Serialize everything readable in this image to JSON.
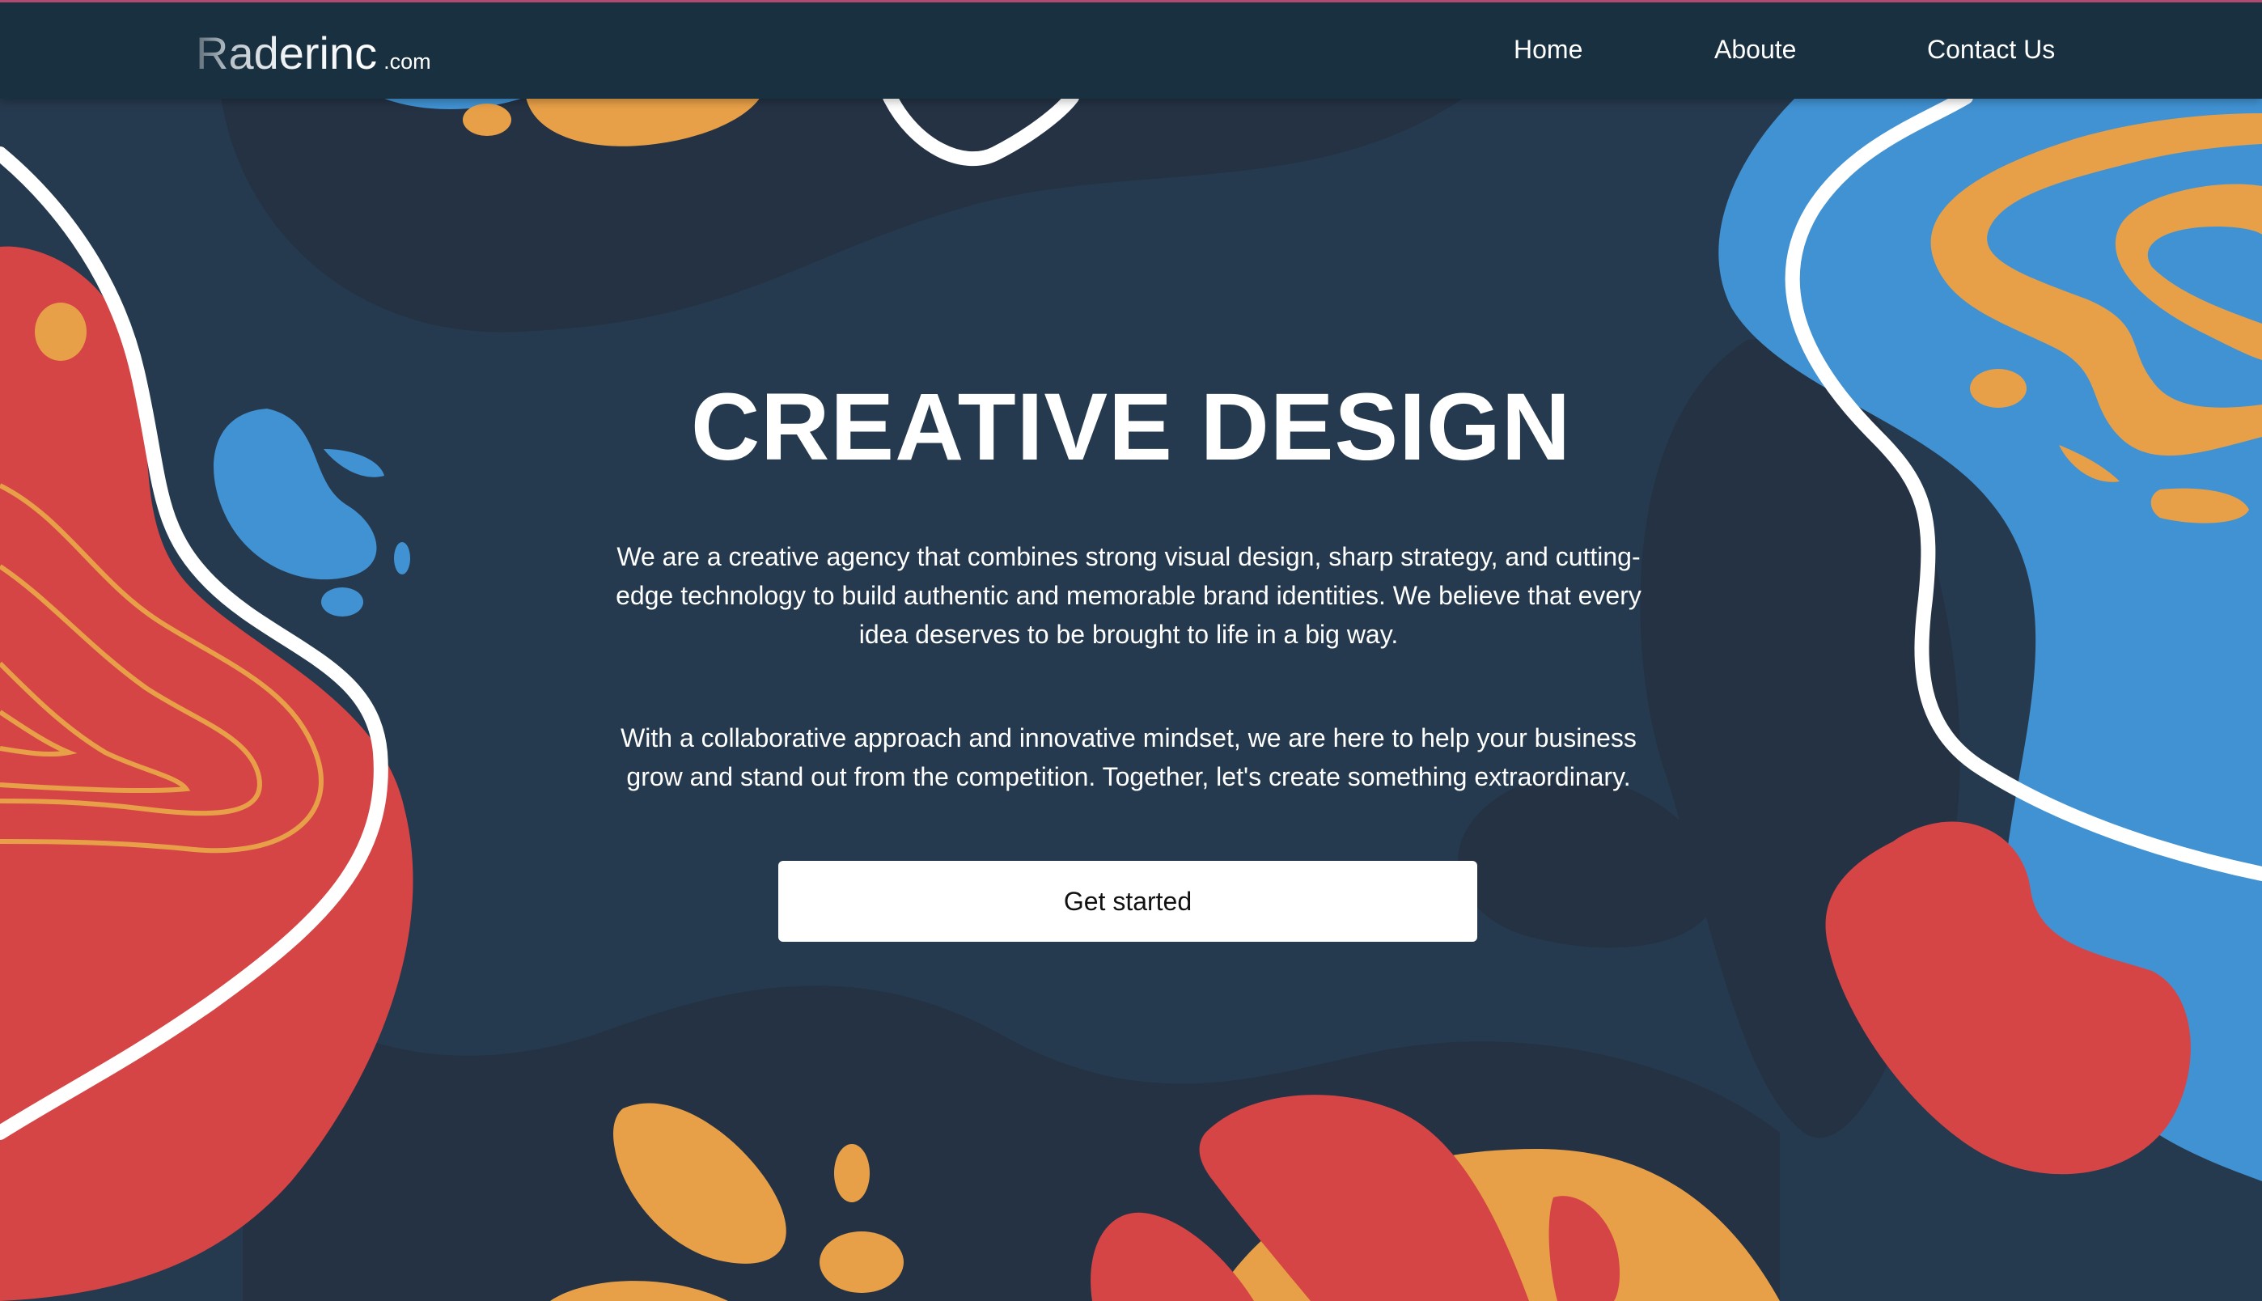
{
  "navbar": {
    "brand_name": "Raderinc",
    "brand_suffix": ".com",
    "links": [
      {
        "label": "Home"
      },
      {
        "label": "Aboute"
      },
      {
        "label": "Contact Us"
      }
    ]
  },
  "hero": {
    "title": "CREATIVE DESIGN",
    "paragraph_1": "We are a creative agency that combines strong visual design, sharp strategy, and cutting-edge technology to build authentic and memorable brand identities. We believe that every idea deserves to be brought to life in a big way.",
    "paragraph_2": "With a collaborative approach and innovative mindset, we are here to help your business grow and stand out from the competition. Together, let's create something extraordinary.",
    "cta_label": "Get started"
  },
  "colors": {
    "background": "#263a4f",
    "navbar": "#18303f",
    "red": "#d64545",
    "orange": "#e8a048",
    "blue": "#4192d3",
    "white": "#ffffff"
  }
}
